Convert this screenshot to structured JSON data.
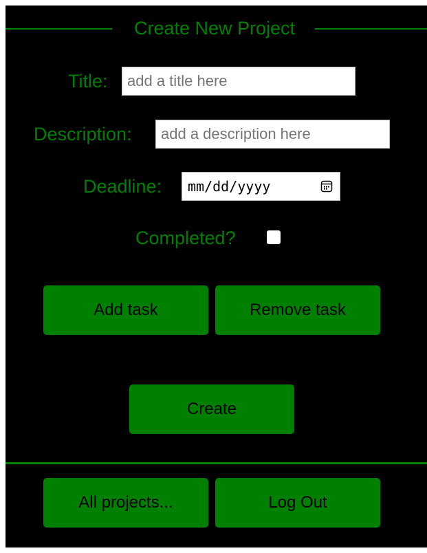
{
  "form": {
    "legend": "Create New Project",
    "title_label": "Title:",
    "title_placeholder": "add a title here",
    "description_label": "Description:",
    "description_placeholder": "add a description here",
    "deadline_label": "Deadline:",
    "deadline_placeholder": "mm/dd/yyyy",
    "completed_label": "Completed?",
    "completed_checked": false,
    "add_task_label": "Add task",
    "remove_task_label": "Remove task",
    "create_label": "Create"
  },
  "footer": {
    "all_projects_label": "All projects...",
    "logout_label": "Log Out"
  },
  "colors": {
    "accent": "#008000",
    "background": "#000000",
    "input_background": "#ffffff",
    "placeholder_text": "#757575"
  },
  "icons": {
    "deadline_picker": "calendar-icon"
  }
}
